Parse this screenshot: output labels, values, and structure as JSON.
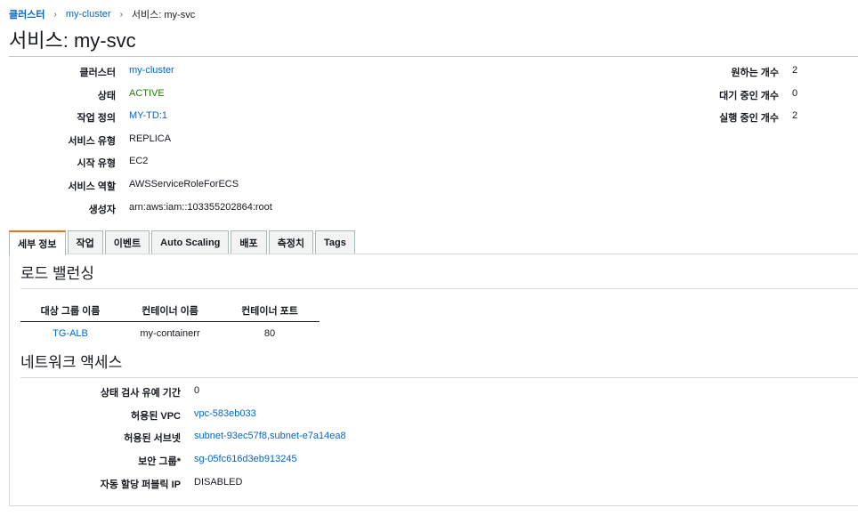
{
  "breadcrumb": {
    "root": "클러스터",
    "cluster": "my-cluster",
    "current": "서비스: my-svc"
  },
  "page": {
    "title": "서비스: my-svc"
  },
  "summary": {
    "left": [
      {
        "label": "클러스터",
        "value": "my-cluster",
        "style": "link"
      },
      {
        "label": "상태",
        "value": "ACTIVE",
        "style": "active"
      },
      {
        "label": "작업 정의",
        "value": "MY-TD:1",
        "style": "link"
      },
      {
        "label": "서비스 유형",
        "value": "REPLICA",
        "style": "plain"
      },
      {
        "label": "시작 유형",
        "value": "EC2",
        "style": "plain"
      },
      {
        "label": "서비스 역할",
        "value": "AWSServiceRoleForECS",
        "style": "plain"
      },
      {
        "label": "생성자",
        "value": "arn:aws:iam::103355202864:root",
        "style": "plain"
      }
    ],
    "right": [
      {
        "label": "원하는 개수",
        "value": "2"
      },
      {
        "label": "대기 중인 개수",
        "value": "0"
      },
      {
        "label": "실행 중인 개수",
        "value": "2"
      }
    ]
  },
  "tabs": [
    {
      "label": "세부 정보",
      "active": true
    },
    {
      "label": "작업",
      "active": false
    },
    {
      "label": "이벤트",
      "active": false
    },
    {
      "label": "Auto Scaling",
      "active": false
    },
    {
      "label": "배포",
      "active": false
    },
    {
      "label": "측정치",
      "active": false
    },
    {
      "label": "Tags",
      "active": false
    }
  ],
  "load_balancing": {
    "title": "로드 밸런싱",
    "columns": [
      "대상 그룹 이름",
      "컨테이너 이름",
      "컨테이너 포트"
    ],
    "rows": [
      [
        "TG-ALB",
        "my-containerr",
        "80"
      ]
    ]
  },
  "network": {
    "title": "네트워크 액세스",
    "rows": [
      {
        "label": "상태 검사 유예 기간",
        "value": "0",
        "style": "plain"
      },
      {
        "label": "허용된 VPC",
        "value": "vpc-583eb033",
        "style": "link"
      },
      {
        "label": "허용된 서브넷",
        "value": "subnet-93ec57f8,subnet-e7a14ea8",
        "style": "link"
      },
      {
        "label": "보안 그룹*",
        "value": "sg-05fc616d3eb913245",
        "style": "link"
      },
      {
        "label": "자동 할당 퍼블릭 IP",
        "value": "DISABLED",
        "style": "plain"
      }
    ]
  },
  "colors": {
    "link": "#0066cc",
    "active_status": "#1d8102",
    "tab_accent": "#ec7211"
  }
}
